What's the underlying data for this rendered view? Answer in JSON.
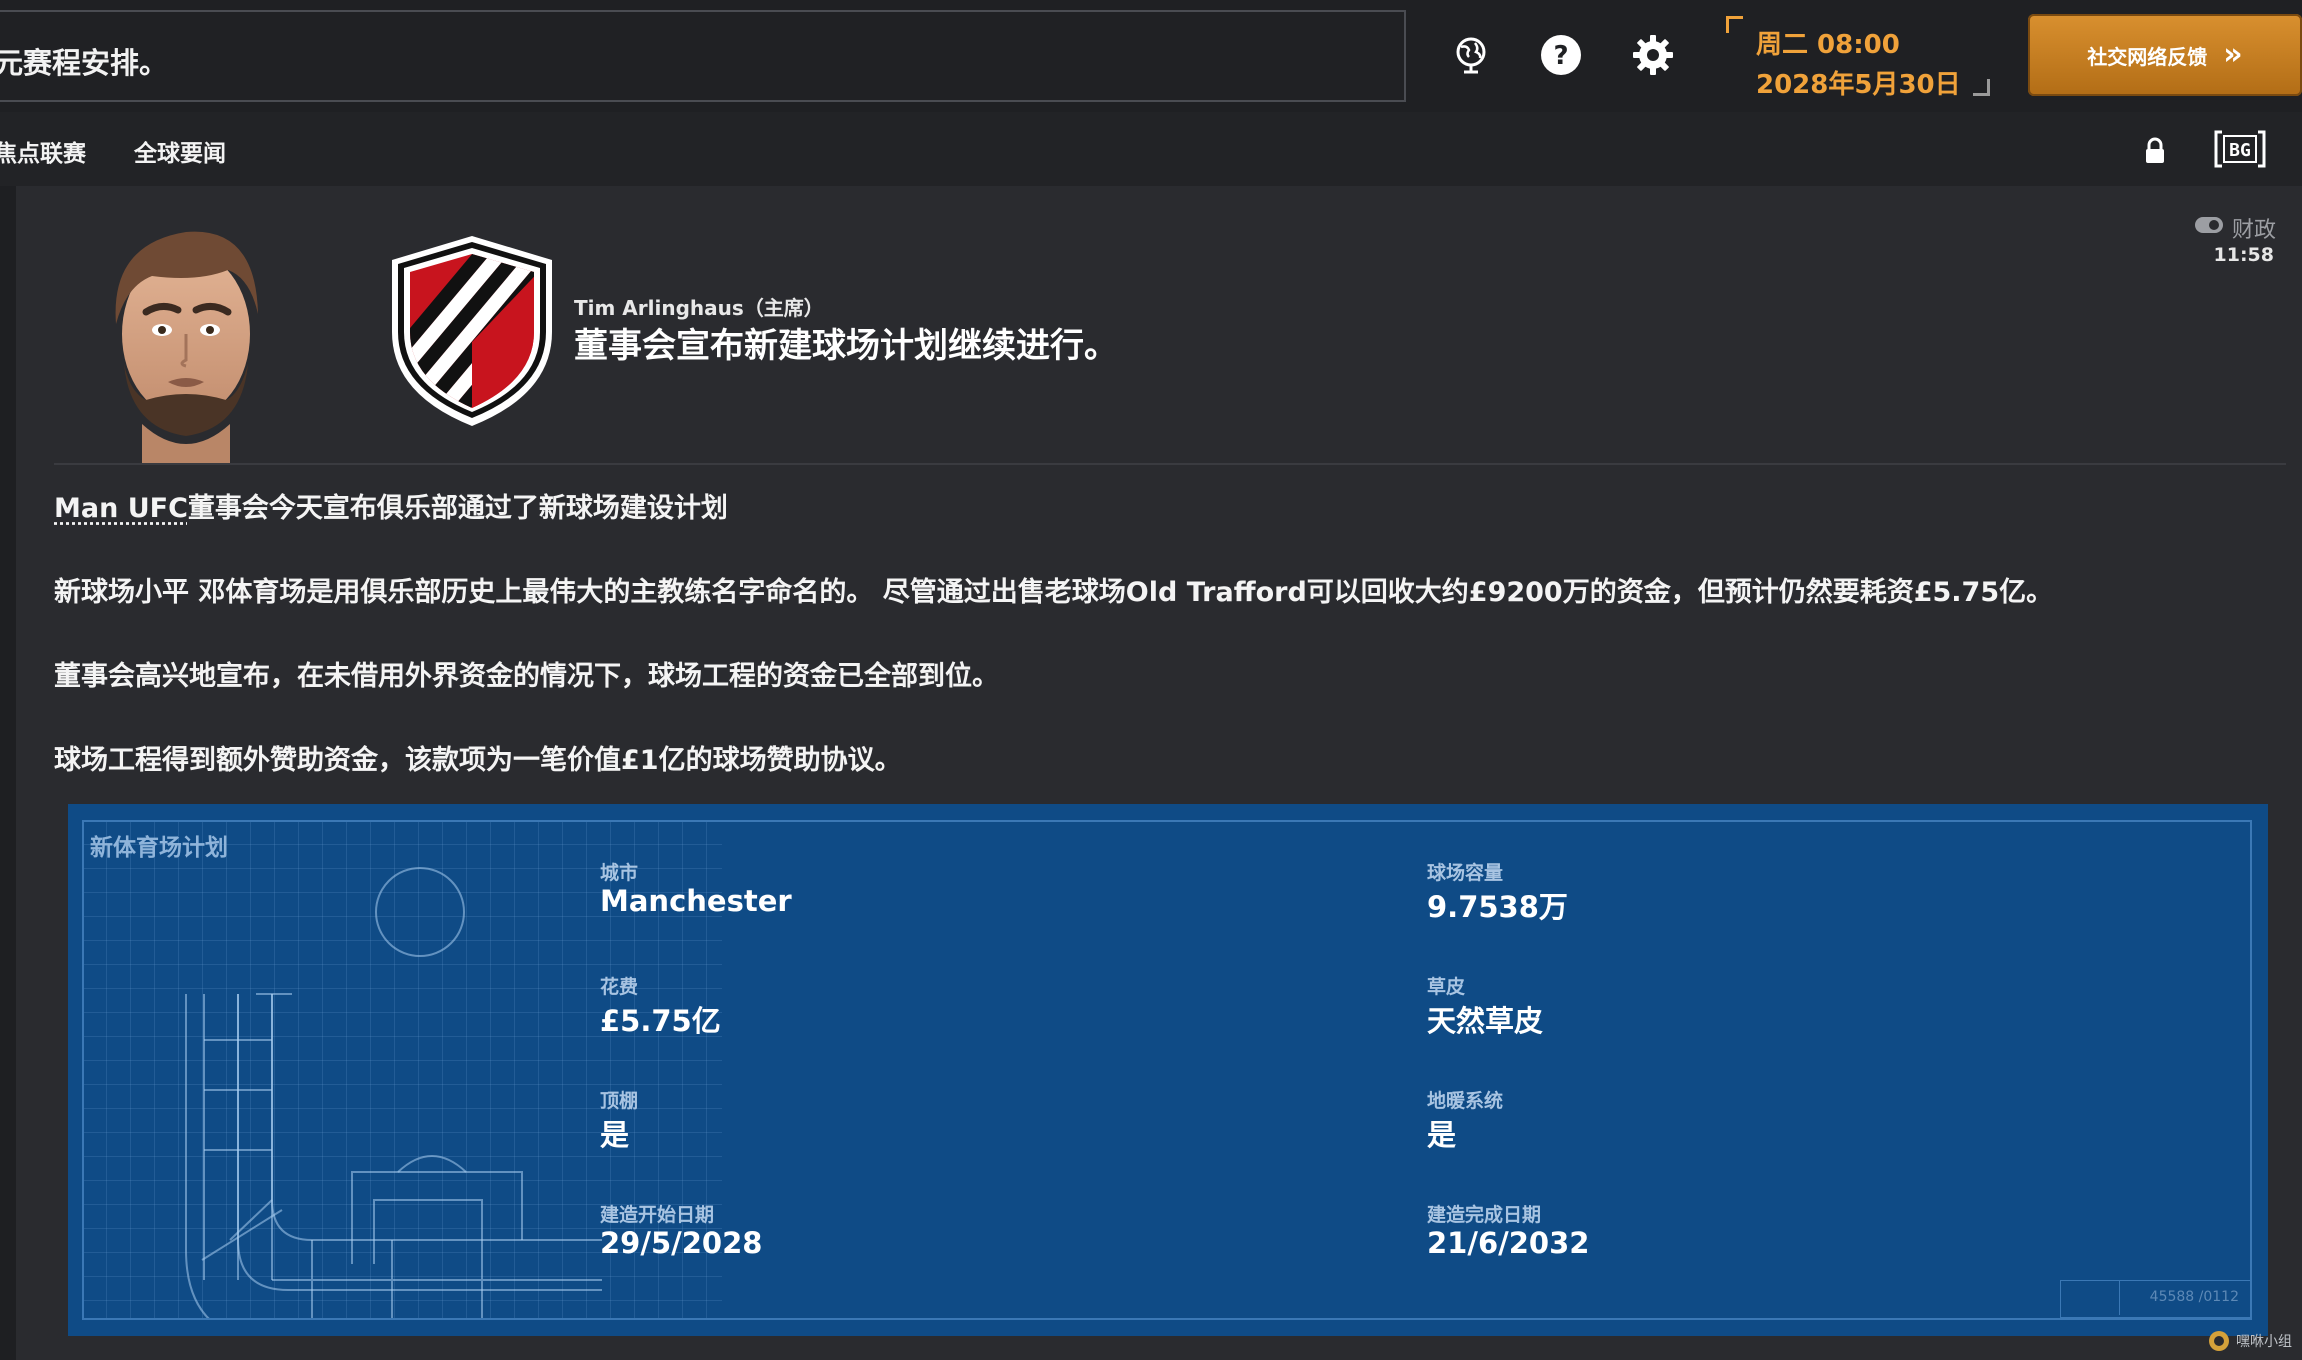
{
  "topbar": {
    "ticker_text": "元赛程安排。",
    "date_line1": "周二 08:00",
    "date_line2": "2028年5月30日",
    "feedback_label": "社交网络反馈",
    "feedback_chevron": "»"
  },
  "nav": {
    "items": [
      {
        "label": "焦点联赛"
      },
      {
        "label": "全球要闻"
      }
    ]
  },
  "news": {
    "category": "财政",
    "time": "11:58",
    "author": "Tim Arlinghaus（主席）",
    "headline": "董事会宣布新建球场计划继续进行。",
    "p1_club": "Man UFC",
    "p1_text": "董事会今天宣布俱乐部通过了新球场建设计划",
    "p2": "新球场小平 邓体育场是用俱乐部历史上最伟大的主教练名字命名的。 尽管通过出售老球场Old Trafford可以回收大约£9200万的资金，但预计仍然要耗资£5.75亿。",
    "p3": "董事会高兴地宣布，在未借用外界资金的情况下，球场工程的资金已全部到位。",
    "p4": "球场工程得到额外赞助资金，该款项为一笔价值£1亿的球场赞助协议。"
  },
  "stadium_card": {
    "title": "新体育场计划",
    "fields": [
      {
        "label": "城市",
        "value": "Manchester"
      },
      {
        "label": "球场容量",
        "value": "9.7538万"
      },
      {
        "label": "花费",
        "value": "£5.75亿"
      },
      {
        "label": "草皮",
        "value": "天然草皮"
      },
      {
        "label": "顶棚",
        "value": "是"
      },
      {
        "label": "地暖系统",
        "value": "是"
      },
      {
        "label": "建造开始日期",
        "value": "29/5/2028"
      },
      {
        "label": "建造完成日期",
        "value": "21/6/2032"
      }
    ],
    "stamp": "45588 /0112"
  },
  "watermark": "嘿咻小组",
  "colors": {
    "accent": "#f0a23a",
    "card_bg": "#0f4b86",
    "crest_red": "#c8141e"
  },
  "icons": [
    "globe-icon",
    "help-icon",
    "settings-gear-icon",
    "lock-icon",
    "bg-toggle-icon",
    "eye-icon"
  ]
}
